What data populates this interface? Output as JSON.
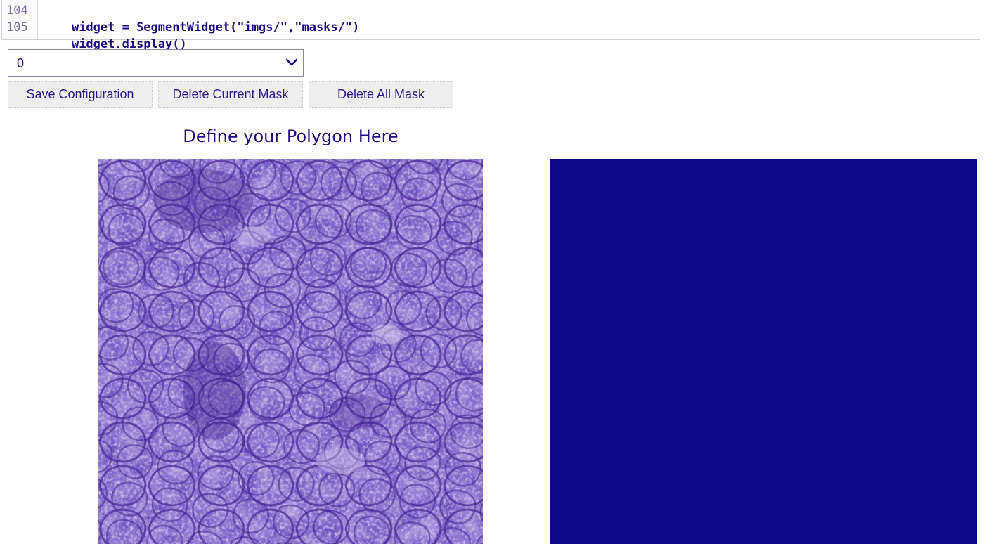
{
  "code_cell": {
    "lines": [
      {
        "number": "104",
        "code": "widget = SegmentWidget(\"imgs/\",\"masks/\")"
      },
      {
        "number": "105",
        "code": "widget.display()"
      }
    ]
  },
  "dropdown": {
    "selected": "0"
  },
  "buttons": {
    "save": "Save Configuration",
    "delete_current": "Delete Current Mask",
    "delete_all": "Delete All Mask"
  },
  "canvas": {
    "title": "Define your Polygon Here"
  },
  "colors": {
    "mask_fill": "#0d0887",
    "image_base": "#6a4fc0",
    "image_light": "#a696da",
    "image_dark": "#4a2a9a",
    "text": "#1a0d80"
  }
}
